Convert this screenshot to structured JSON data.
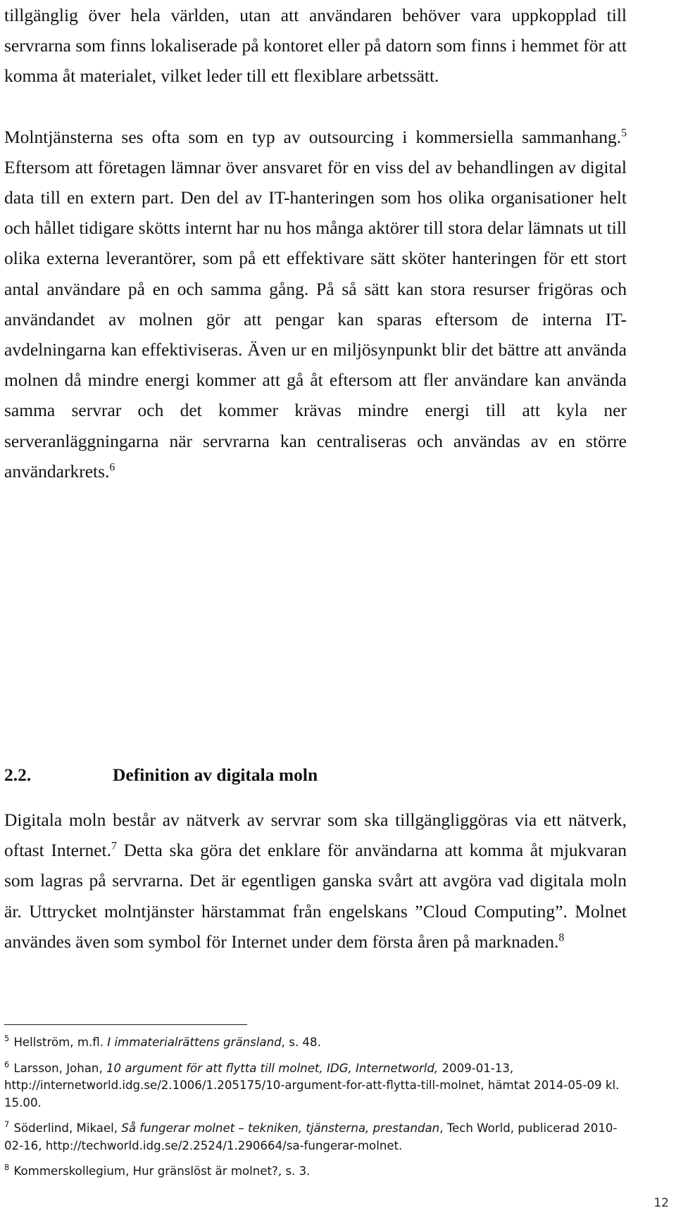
{
  "document": {
    "language": "sv",
    "page_number": "12"
  },
  "paragraphs": {
    "p1_prefix": "tillgänglig över hela världen, utan att användaren behöver vara uppkopplad till servrarna som finns lokaliserade på kontoret eller på datorn som finns i hemmet för att komma åt materialet, vilket leder till ett flexiblare arbetssätt.",
    "p2_a": "Molntjänsterna ses ofta som en typ av outsourcing i kommersiella sammanhang.",
    "p2_ref": "5",
    "p2_b": " Eftersom att företagen lämnar över ansvaret för en viss del av behandlingen av digital data till en extern part. Den del av IT-hanteringen som hos olika organisationer helt och hållet tidigare skötts internt har nu hos många aktörer till stora delar lämnats ut till olika externa leverantörer, som på ett effektivare sätt sköter hanteringen för ett stort antal användare på en och samma gång. På så sätt kan stora resurser frigöras och användandet av molnen gör att pengar kan sparas eftersom de interna IT-avdelningarna kan effektiviseras. Även ur en miljösynpunkt blir det bättre att använda molnen då mindre energi kommer att gå åt eftersom att fler användare kan använda samma servrar och det kommer krävas mindre energi till att kyla ner serveranläggningarna när servrarna kan centraliseras och användas av en större användarkrets.",
    "p2_ref2": "6",
    "p3_a": "Digitala moln består av nätverk av servrar som ska tillgängliggöras via ett nätverk, oftast Internet.",
    "p3_ref": "7",
    "p3_b": " Detta ska göra det enklare för användarna att komma åt mjukvaran som lagras på servrarna. Det är egentligen ganska svårt att avgöra vad digitala moln är. Uttrycket molntjänster härstammat från engelskans ”Cloud Computing”. Molnet användes även som symbol för Internet under dem första åren på marknaden.",
    "p3_ref2": "8"
  },
  "heading": {
    "number": "2.2.",
    "title": "Definition av digitala moln"
  },
  "footnotes": [
    {
      "number": "5",
      "pre": " Hellström, m.fl. ",
      "italic": "I immaterialrättens gränsland",
      "post": ", s. 48."
    },
    {
      "number": "6",
      "pre": " Larsson, Johan, ",
      "italic": "10 argument för att flytta till molnet, IDG, Internetworld,",
      "post": " 2009-01-13, http://internetworld.idg.se/2.1006/1.205175/10-argument-for-att-flytta-till-molnet, hämtat 2014-05-09 kl. 15.00."
    },
    {
      "number": "7",
      "pre": " Söderlind, Mikael, ",
      "italic": "Så fungerar molnet – tekniken, tjänsterna, prestandan",
      "post": ", Tech World, publicerad 2010-02-16, http://techworld.idg.se/2.2524/1.290664/sa-fungerar-molnet."
    },
    {
      "number": "8",
      "pre": " Kommerskollegium, Hur gränslöst är molnet?, s. 3.",
      "italic": "",
      "post": ""
    }
  ]
}
